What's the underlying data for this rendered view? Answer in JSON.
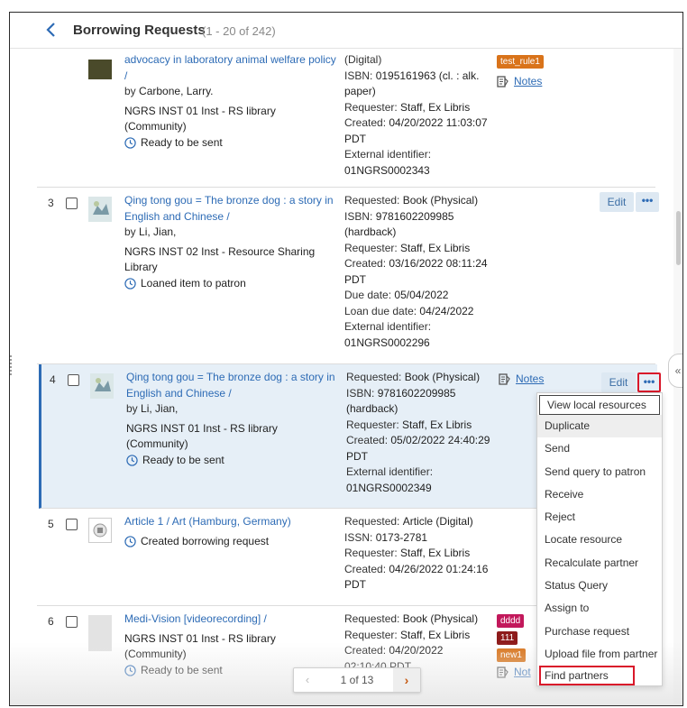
{
  "header": {
    "title": "Borrowing Requests",
    "count": "(1 - 20 of 242)"
  },
  "rows": [
    {
      "num": "",
      "title": "advocacy in laboratory animal welfare policy /",
      "author_prefix": "by",
      "author": "Carbone, Larry.",
      "library": "NGRS INST 01 Inst - RS library (Community)",
      "status": "Ready to be sent",
      "details": [
        {
          "text": "(Digital)"
        },
        {
          "label": "ISBN:",
          "value": "0195161963 (cl. : alk. paper)"
        },
        {
          "label": "Requester:",
          "value": "Staff, Ex Libris"
        },
        {
          "label": "Created:",
          "value": "04/20/2022 11:03:07 PDT"
        },
        {
          "label": "External identifier:",
          "value": "01NGRS0002343"
        }
      ],
      "tags": [
        {
          "text": "test_rule1",
          "color": "#d9731a"
        }
      ],
      "notes": "Notes"
    },
    {
      "num": "3",
      "title": "Qing tong gou = The bronze dog : a story in English and Chinese /",
      "author_prefix": "by",
      "author": "Li, Jian,",
      "library": "NGRS INST 02 Inst - Resource Sharing Library",
      "status": "Loaned item to patron",
      "details": [
        {
          "label": "Requested:",
          "value": "Book (Physical)"
        },
        {
          "label": "ISBN:",
          "value": "9781602209985 (hardback)"
        },
        {
          "label": "Requester:",
          "value": "Staff, Ex Libris"
        },
        {
          "label": "Created:",
          "value": "03/16/2022 08:11:24 PDT"
        },
        {
          "label": "Due date:",
          "value": "05/04/2022"
        },
        {
          "label": "Loan due date:",
          "value": "04/24/2022"
        },
        {
          "label": "External identifier:",
          "value": "01NGRS0002296"
        }
      ],
      "edit": "Edit",
      "more": "•••"
    },
    {
      "num": "4",
      "title": "Qing tong gou = The bronze dog : a story in English and Chinese /",
      "author_prefix": "by",
      "author": "Li, Jian,",
      "library": "NGRS INST 01 Inst - RS library (Community)",
      "status": "Ready to be sent",
      "details": [
        {
          "label": "Requested:",
          "value": "Book (Physical)"
        },
        {
          "label": "ISBN:",
          "value": "9781602209985 (hardback)"
        },
        {
          "label": "Requester:",
          "value": "Staff, Ex Libris"
        },
        {
          "label": "Created:",
          "value": "05/02/2022 24:40:29 PDT"
        },
        {
          "label": "External identifier:",
          "value": "01NGRS0002349"
        }
      ],
      "notes": "Notes",
      "edit": "Edit",
      "more": "•••"
    },
    {
      "num": "5",
      "title": "Article 1 / Art (Hamburg, Germany)",
      "status": "Created borrowing request",
      "details": [
        {
          "label": "Requested:",
          "value": "Article (Digital)"
        },
        {
          "label": "ISSN:",
          "value": "0173-2781"
        },
        {
          "label": "Requester:",
          "value": "Staff, Ex Libris"
        },
        {
          "label": "Created:",
          "value": "04/26/2022 01:24:16 PDT"
        }
      ]
    },
    {
      "num": "6",
      "title": "Medi-Vision [videorecording] /",
      "library": "NGRS INST 01 Inst - RS library (Community)",
      "status": "Ready to be sent",
      "details": [
        {
          "label": "Requested:",
          "value": "Book (Physical)"
        },
        {
          "label": "Requester:",
          "value": "Staff, Ex Libris"
        },
        {
          "label": "Created:",
          "value": "04/20/2022"
        },
        {
          "text": "02:10:40 PDT"
        }
      ],
      "tags": [
        {
          "text": "dddd",
          "color": "#c2185b"
        },
        {
          "text": "111",
          "color": "#8e1b1b"
        },
        {
          "text": "new1",
          "color": "#d9731a"
        }
      ],
      "notes": "Not"
    }
  ],
  "menu": {
    "items": [
      "View local resources",
      "Duplicate",
      "Send",
      "Send query to patron",
      "Receive",
      "Reject",
      "Locate resource",
      "Recalculate partner",
      "Status Query",
      "Assign to",
      "Purchase request",
      "Upload file from partner",
      "Find partners"
    ]
  },
  "pager": {
    "text": "1 of 13",
    "prev": "‹",
    "next": "›"
  },
  "colors": {
    "link": "#2d6bb5",
    "highlight_box": "#d9182a",
    "selected_row": "#e6eff7"
  }
}
